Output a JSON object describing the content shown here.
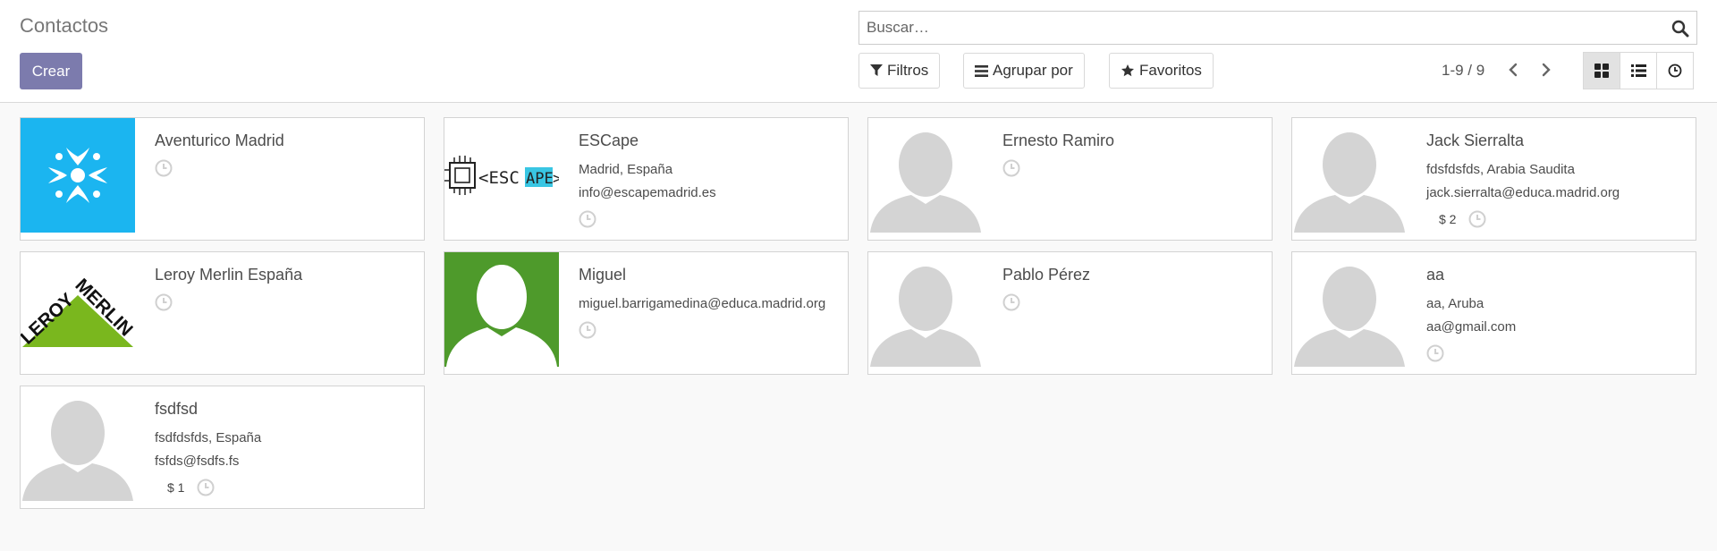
{
  "header": {
    "title": "Contactos",
    "create_label": "Crear"
  },
  "search": {
    "placeholder": "Buscar…"
  },
  "toolbar": {
    "filters_label": "Filtros",
    "groupby_label": "Agrupar por",
    "favorites_label": "Favoritos"
  },
  "pager": {
    "value": "1-9 / 9"
  },
  "colors": {
    "accent": "#7c7bad",
    "placeholder_gray": "#d4d4d4",
    "aventurico_blue": "#1bb5f0",
    "miguel_green": "#4e9a2b",
    "leroy_green": "#7ab71e"
  },
  "cards": [
    {
      "name": "Aventurico Madrid",
      "line1": "",
      "line2": "",
      "badge": "",
      "avatar": "aventurico-logo"
    },
    {
      "name": "ESCape",
      "line1": "Madrid, España",
      "line2": "info@escapemadrid.es",
      "badge": "",
      "avatar": "escape-logo",
      "logo_text_a": "<ESC",
      "logo_text_b": "APE",
      "logo_text_c": ">"
    },
    {
      "name": "Ernesto Ramiro",
      "line1": "",
      "line2": "",
      "badge": "",
      "avatar": "placeholder"
    },
    {
      "name": "Jack Sierralta",
      "line1": "fdsfdsfds, Arabia Saudita",
      "line2": "jack.sierralta@educa.madrid.org",
      "badge": "$ 2",
      "avatar": "placeholder"
    },
    {
      "name": "Leroy Merlin España",
      "line1": "",
      "line2": "",
      "badge": "",
      "avatar": "leroy-merlin-logo",
      "logo_text_a": "LEROY",
      "logo_text_b": "MERLIN"
    },
    {
      "name": "Miguel",
      "line1": "miguel.barrigamedina@educa.madrid.org",
      "line2": "",
      "badge": "",
      "avatar": "green-placeholder"
    },
    {
      "name": "Pablo Pérez",
      "line1": "",
      "line2": "",
      "badge": "",
      "avatar": "placeholder"
    },
    {
      "name": "aa",
      "line1": "aa, Aruba",
      "line2": "aa@gmail.com",
      "badge": "",
      "avatar": "placeholder"
    },
    {
      "name": "fsdfsd",
      "line1": "fsdfdsfds, España",
      "line2": "fsfds@fsdfs.fs",
      "badge": "$ 1",
      "avatar": "placeholder"
    }
  ]
}
